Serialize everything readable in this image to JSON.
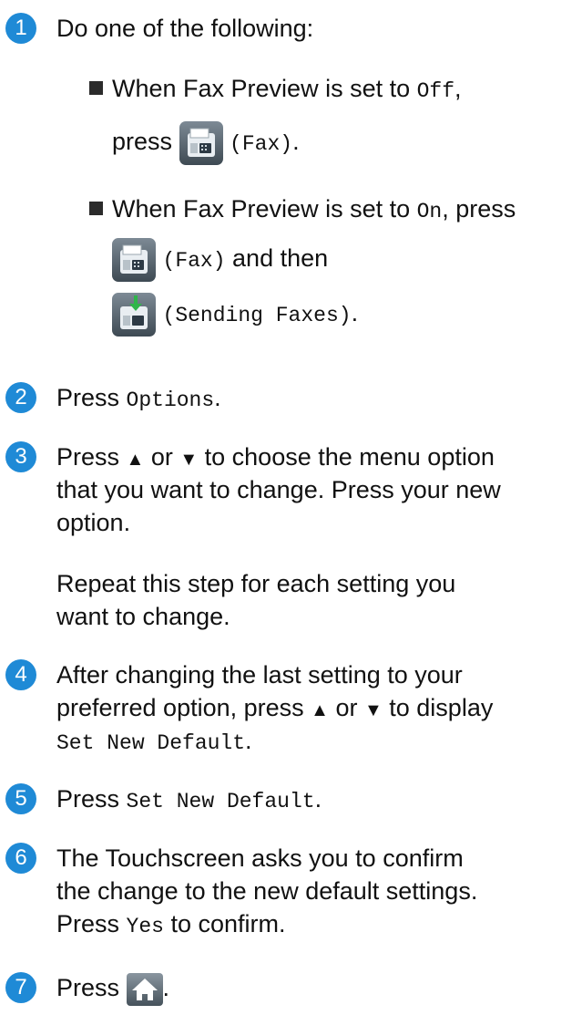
{
  "steps": [
    {
      "num": "1",
      "intro": "Do one of the following:",
      "bullets": [
        {
          "line1_text": "When Fax Preview is set to ",
          "line1_mono": "Off",
          "line1_end": ",",
          "line2_pre": "press ",
          "line2_mono": "(Fax)",
          "line2_end": "."
        },
        {
          "line1_text": "When Fax Preview is set to ",
          "line1_mono": "On",
          "line1_end": ", press",
          "line2_mono": "(Fax)",
          "line2_end": " and then",
          "line3_mono": "(Sending Faxes)",
          "line3_end": "."
        }
      ]
    },
    {
      "num": "2",
      "pre": "Press ",
      "mono": "Options",
      "end": "."
    },
    {
      "num": "3",
      "line1_pre": "Press ",
      "line1_post": " to choose the menu option",
      "line2": "that you want to change. Press your new",
      "line3": "option.",
      "line4": "Repeat this step for each setting you",
      "line5": "want to change.",
      "arrow_up": "▲",
      "or_word": " or ",
      "arrow_down": "▼"
    },
    {
      "num": "4",
      "line1": "After changing the last setting to your",
      "line2_pre": "preferred option, press ",
      "line2_post": " to display",
      "line3_mono": "Set New Default",
      "line3_end": "."
    },
    {
      "num": "5",
      "pre": "Press ",
      "mono": "Set New Default",
      "end": "."
    },
    {
      "num": "6",
      "line1": "The Touchscreen asks you to confirm",
      "line2": "the change to the new default settings.",
      "line3_pre": "Press ",
      "line3_mono": "Yes",
      "line3_post": " to confirm."
    },
    {
      "num": "7",
      "pre": "Press ",
      "end": "."
    }
  ],
  "icons": {
    "fax": "fax-button-icon",
    "sending_faxes": "sending-faxes-button-icon",
    "home": "home-button-icon"
  }
}
